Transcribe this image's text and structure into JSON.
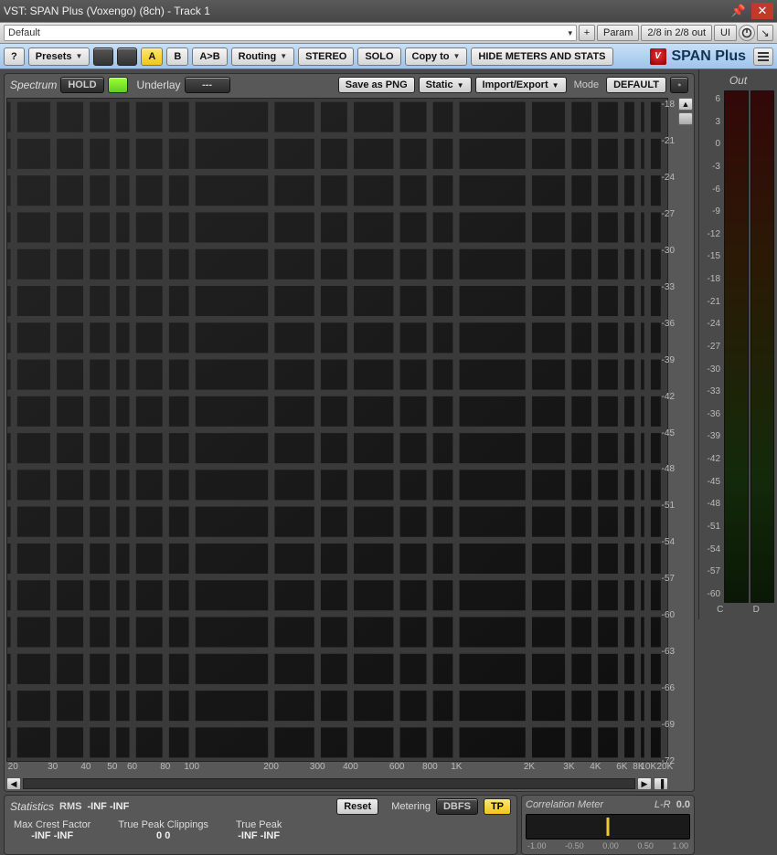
{
  "window": {
    "title": "VST: SPAN Plus (Voxengo) (8ch) - Track 1"
  },
  "hostbar": {
    "preset": "Default",
    "plus": "+",
    "param": "Param",
    "io": "2/8 in 2/8 out",
    "ui": "UI"
  },
  "pluginbar": {
    "help": "?",
    "presets": "Presets",
    "a": "A",
    "b": "B",
    "atob": "A>B",
    "routing": "Routing",
    "stereo": "STEREO",
    "solo": "SOLO",
    "copyto": "Copy to",
    "hide": "HIDE METERS AND STATS",
    "brand": "SPAN Plus"
  },
  "spectrum": {
    "label": "Spectrum",
    "hold": "HOLD",
    "underlay": "Underlay",
    "underlay_val": "---",
    "savepng": "Save as PNG",
    "static": "Static",
    "importexport": "Import/Export",
    "mode": "Mode",
    "default": "DEFAULT"
  },
  "yscale": [
    "-18",
    "-21",
    "-24",
    "-27",
    "-30",
    "-33",
    "-36",
    "-39",
    "-42",
    "-45",
    "-48",
    "-51",
    "-54",
    "-57",
    "-60",
    "-63",
    "-66",
    "-69",
    "-72"
  ],
  "xscale": [
    {
      "l": "20",
      "p": 1
    },
    {
      "l": "30",
      "p": 7
    },
    {
      "l": "40",
      "p": 12
    },
    {
      "l": "50",
      "p": 16
    },
    {
      "l": "60",
      "p": 19
    },
    {
      "l": "80",
      "p": 24
    },
    {
      "l": "100",
      "p": 28
    },
    {
      "l": "200",
      "p": 40
    },
    {
      "l": "300",
      "p": 47
    },
    {
      "l": "400",
      "p": 52
    },
    {
      "l": "600",
      "p": 59
    },
    {
      "l": "800",
      "p": 64
    },
    {
      "l": "1K",
      "p": 68
    },
    {
      "l": "2K",
      "p": 79
    },
    {
      "l": "3K",
      "p": 85
    },
    {
      "l": "4K",
      "p": 89
    },
    {
      "l": "6K",
      "p": 93
    },
    {
      "l": "8K",
      "p": 95.5
    },
    {
      "l": "10K",
      "p": 97
    },
    {
      "l": "20K",
      "p": 99.5
    }
  ],
  "stats": {
    "label": "Statistics",
    "rms": "RMS",
    "rms_val": "-INF  -INF",
    "reset": "Reset",
    "metering": "Metering",
    "dbfs": "DBFS",
    "tp": "TP",
    "crest_label": "Max Crest Factor",
    "crest_val": "-INF   -INF",
    "tpc_label": "True Peak Clippings",
    "tpc_val": "0        0",
    "tpk_label": "True Peak",
    "tpk_val": "-INF   -INF"
  },
  "corr": {
    "label": "Correlation Meter",
    "lr": "L-R",
    "val": "0.0",
    "scale": [
      "-1.00",
      "-0.50",
      "0.00",
      "0.50",
      "1.00"
    ]
  },
  "out": {
    "label": "Out",
    "scale": [
      "6",
      "3",
      "0",
      "-3",
      "-6",
      "-9",
      "-12",
      "-15",
      "-18",
      "-21",
      "-24",
      "-27",
      "-30",
      "-33",
      "-36",
      "-39",
      "-42",
      "-45",
      "-48",
      "-51",
      "-54",
      "-57",
      "-60"
    ],
    "c": "C",
    "d": "D"
  }
}
